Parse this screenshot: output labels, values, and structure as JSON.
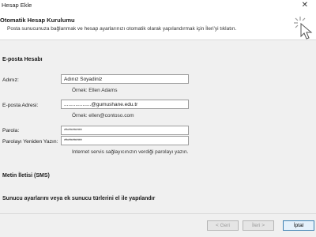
{
  "window": {
    "title": "Hesap Ekle",
    "close_glyph": "✕"
  },
  "header": {
    "title": "Otomatik Hesap Kurulumu",
    "description": "Posta sunucunuza bağlanmak ve hesap ayarlarınızı otomatik olarak yapılandırmak için İleri'yi tıklatın."
  },
  "email_section": {
    "heading": "E-posta Hesabı",
    "name_label": "Adınız:",
    "name_value": "Adınız Soyadiniz",
    "name_hint": "Örnek: Ellen Adams",
    "email_label": "E-posta Adresi:",
    "email_value": "...................@gumushane.edu.tr",
    "email_hint": "Örnek: ellen@contoso.com",
    "password_label": "Parola:",
    "password_value": "*********",
    "password_confirm_label": "Parolayı Yeniden Yazın:",
    "password_confirm_value": "*********",
    "password_hint": "Internet servis sağlayıcınızın verdiği parolayı yazın."
  },
  "sms_section": {
    "heading": "Metin İletisi (SMS)"
  },
  "manual_section": {
    "heading": "Sunucu ayarlarını veya ek sunucu türlerini el ile yapılandır"
  },
  "buttons": {
    "back": "< Geri",
    "next": "İleri >",
    "cancel": "İptal"
  },
  "icons": {
    "header_art": "cursor-click-icon",
    "close": "close-icon"
  }
}
